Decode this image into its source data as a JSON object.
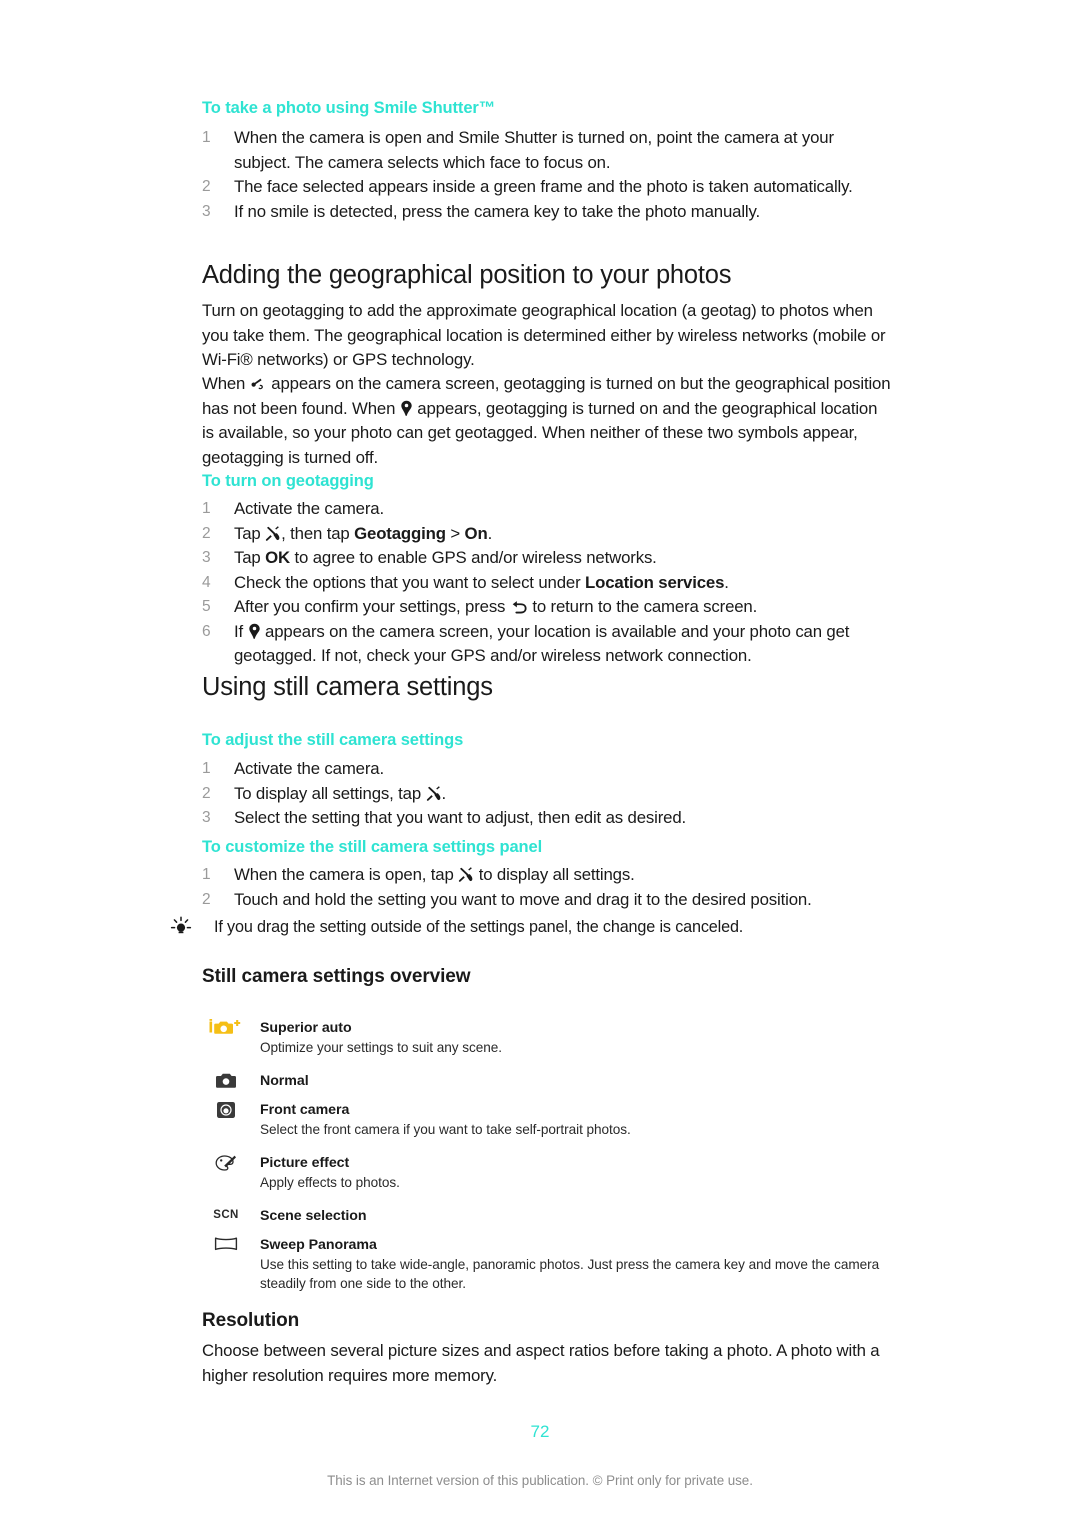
{
  "document": {
    "page_number": "72",
    "footer_note": "This is an Internet version of this publication. © Print only for private use.",
    "accent_color": "#2fe3d2",
    "icon_highlight_color": "#f5bf16"
  },
  "smile_shutter": {
    "procedure_title": "To take a photo using Smile Shutter™",
    "steps": [
      {
        "num": "1",
        "text": "When the camera is open and Smile Shutter is turned on, point the camera at your subject. The camera selects which face to focus on."
      },
      {
        "num": "2",
        "text": "The face selected appears inside a green frame and the photo is taken automatically."
      },
      {
        "num": "3",
        "text": "If no smile is detected, press the camera key to take the photo manually."
      }
    ]
  },
  "geotagging": {
    "section_title": "Adding the geographical position to your photos",
    "paragraph_1": "Turn on geotagging to add the approximate geographical location (a geotag) to photos when you take them. The geographical location is determined either by wireless networks (mobile or Wi-Fi® networks) or GPS technology.",
    "paragraph_2": {
      "part_1": "When ",
      "icon_1": "gps-searching-icon",
      "part_2": " appears on the camera screen, geotagging is turned on but the geographical position has not been found. When ",
      "icon_2": "location-pin-icon",
      "part_3": " appears, geotagging is turned on and the geographical location is available, so your photo can get geotagged. When neither of these two symbols appear, geotagging is turned off."
    },
    "procedure_title": "To turn on geotagging",
    "steps": [
      {
        "num": "1",
        "text": "Activate the camera."
      },
      {
        "num": "2",
        "text_before": "Tap ",
        "icon": "tools-settings-icon",
        "text_mid": ", then tap ",
        "bold_1": "Geotagging",
        "text_mid_2": " > ",
        "bold_2": "On",
        "text_after": "."
      },
      {
        "num": "3",
        "text_before": "Tap ",
        "bold_1": "OK",
        "text_after": " to agree to enable GPS and/or wireless networks."
      },
      {
        "num": "4",
        "text_before": "Check the options that you want to select under ",
        "bold_1": "Location services",
        "text_after": "."
      },
      {
        "num": "5",
        "text_before": "After you confirm your settings, press ",
        "icon": "back-arrow-icon",
        "text_after": " to return to the camera screen."
      },
      {
        "num": "6",
        "text_before": "If ",
        "icon": "location-pin-icon",
        "text_after": " appears on the camera screen, your location is available and your photo can get geotagged. If not, check your GPS and/or wireless network connection."
      }
    ]
  },
  "still_settings": {
    "section_title": "Using still camera settings",
    "adjust": {
      "procedure_title": "To adjust the still camera settings",
      "steps": [
        {
          "num": "1",
          "text": "Activate the camera."
        },
        {
          "num": "2",
          "text_before": "To display all settings, tap ",
          "icon": "tools-settings-icon",
          "text_after": "."
        },
        {
          "num": "3",
          "text": "Select the setting that you want to adjust, then edit as desired."
        }
      ]
    },
    "customize": {
      "procedure_title": "To customize the still camera settings panel",
      "steps": [
        {
          "num": "1",
          "text_before": "When the camera is open, tap ",
          "icon": "tools-settings-icon",
          "text_after": " to display all settings."
        },
        {
          "num": "2",
          "text": "Touch and hold the setting you want to move and drag it to the desired position."
        }
      ],
      "tip": "If you drag the setting outside of the settings panel, the change is canceled."
    }
  },
  "overview": {
    "title": "Still camera settings overview",
    "items": [
      {
        "icon": "superior-auto-icon",
        "name": "Superior auto",
        "desc": "Optimize your settings to suit any scene."
      },
      {
        "icon": "camera-normal-icon",
        "name": "Normal",
        "desc": ""
      },
      {
        "icon": "front-camera-icon",
        "name": "Front camera",
        "desc": "Select the front camera if you want to take self-portrait photos."
      },
      {
        "icon": "picture-effect-icon",
        "name": "Picture effect",
        "desc": "Apply effects to photos."
      },
      {
        "icon": "scene-selection-icon",
        "name": "Scene selection",
        "desc": ""
      },
      {
        "icon": "sweep-panorama-icon",
        "name": "Sweep Panorama",
        "desc": "Use this setting to take wide-angle, panoramic photos. Just press the camera key and move the camera steadily from one side to the other."
      }
    ]
  },
  "resolution": {
    "title": "Resolution",
    "paragraph": "Choose between several picture sizes and aspect ratios before taking a photo. A photo with a higher resolution requires more memory."
  }
}
